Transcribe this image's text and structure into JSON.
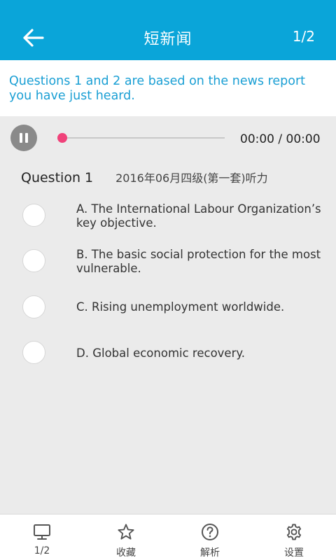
{
  "header": {
    "title": "短新闻",
    "page_counter": "1/2",
    "color": "#0aa5d9"
  },
  "instructions": "Questions 1 and 2 are based on the news report you have just heard.",
  "player": {
    "state": "playing",
    "time": "00:00 / 00:00",
    "progress": 0,
    "thumb_color": "#f0427a"
  },
  "question": {
    "number": "Question 1",
    "source": "2016年06月四级(第一套)听力",
    "options": [
      {
        "text": "A. The International Labour Organization’s key objective."
      },
      {
        "text": "B. The basic social protection for the most vulnerable."
      },
      {
        "text": "C. Rising unemployment worldwide."
      },
      {
        "text": "D. Global economic recovery."
      }
    ]
  },
  "bottom_nav": [
    {
      "label": "1/2",
      "icon": "monitor-icon"
    },
    {
      "label": "收藏",
      "icon": "star-icon"
    },
    {
      "label": "解析",
      "icon": "help-icon"
    },
    {
      "label": "设置",
      "icon": "gear-icon"
    }
  ]
}
